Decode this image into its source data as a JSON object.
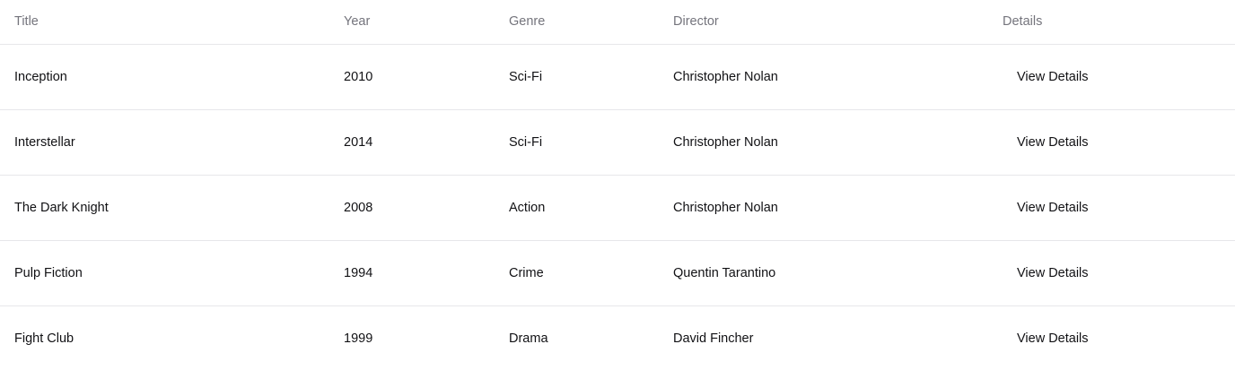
{
  "table": {
    "headers": {
      "title": "Title",
      "year": "Year",
      "genre": "Genre",
      "director": "Director",
      "details": "Details"
    },
    "rows": [
      {
        "title": "Inception",
        "year": "2010",
        "genre": "Sci-Fi",
        "director": "Christopher Nolan",
        "action": "View Details"
      },
      {
        "title": "Interstellar",
        "year": "2014",
        "genre": "Sci-Fi",
        "director": "Christopher Nolan",
        "action": "View Details"
      },
      {
        "title": "The Dark Knight",
        "year": "2008",
        "genre": "Action",
        "director": "Christopher Nolan",
        "action": "View Details"
      },
      {
        "title": "Pulp Fiction",
        "year": "1994",
        "genre": "Crime",
        "director": "Quentin Tarantino",
        "action": "View Details"
      },
      {
        "title": "Fight Club",
        "year": "1999",
        "genre": "Drama",
        "director": "David Fincher",
        "action": "View Details"
      }
    ]
  }
}
